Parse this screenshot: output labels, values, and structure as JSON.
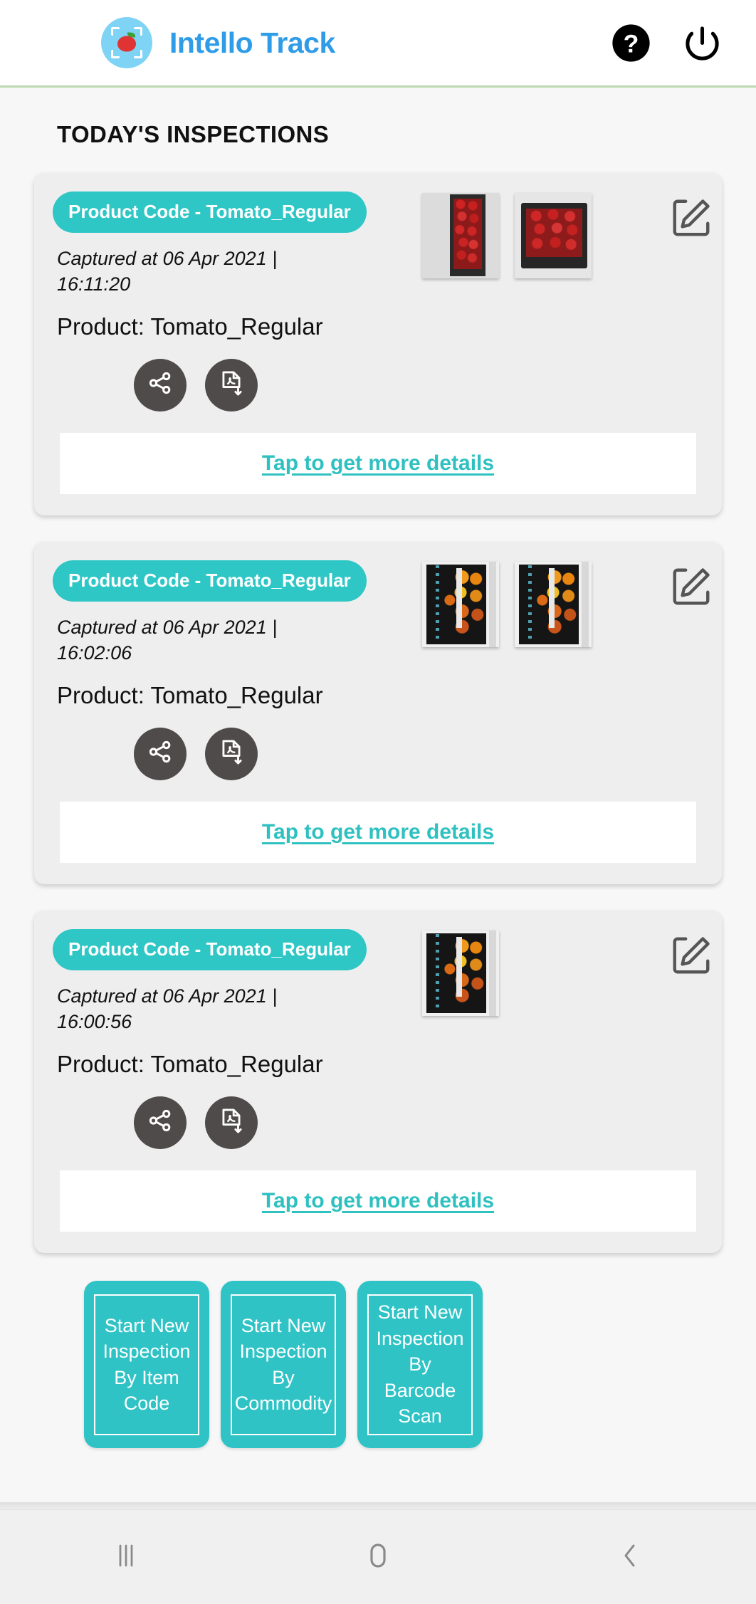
{
  "appbar": {
    "title": "Intello Track",
    "logo_icon": "apple-scan-logo-icon",
    "help_icon": "help-circle-icon",
    "power_icon": "power-icon",
    "brand_color": "#2f9ce8",
    "accent_color": "#2fc6c6"
  },
  "page_title": "TODAY'S INSPECTIONS",
  "cards": [
    {
      "pill": "Product Code - Tomato_Regular",
      "captured": "Captured at 06 Apr 2021 | 16:11:20",
      "product": "Product: Tomato_Regular",
      "share_icon": "share-icon",
      "download_icon": "pdf-download-icon",
      "edit_icon": "edit-pencil-icon",
      "details_link": "Tap to get more details",
      "thumb_count": 2
    },
    {
      "pill": "Product Code - Tomato_Regular",
      "captured": "Captured at 06 Apr 2021 | 16:02:06",
      "product": "Product: Tomato_Regular",
      "share_icon": "share-icon",
      "download_icon": "pdf-download-icon",
      "edit_icon": "edit-pencil-icon",
      "details_link": "Tap to get more details",
      "thumb_count": 2
    },
    {
      "pill": "Product Code - Tomato_Regular",
      "captured": "Captured at 06 Apr 2021 | 16:00:56",
      "product": "Product: Tomato_Regular",
      "share_icon": "share-icon",
      "download_icon": "pdf-download-icon",
      "edit_icon": "edit-pencil-icon",
      "details_link": "Tap to get more details",
      "thumb_count": 1
    }
  ],
  "fabs": [
    {
      "label": "Start New Inspection By Item Code"
    },
    {
      "label": "Start New Inspection By Commodity"
    },
    {
      "label": "Start New Inspection By Barcode Scan"
    }
  ],
  "navbar": {
    "recents_icon": "recents-icon",
    "home_icon": "home-icon",
    "back_icon": "back-chevron-icon"
  }
}
